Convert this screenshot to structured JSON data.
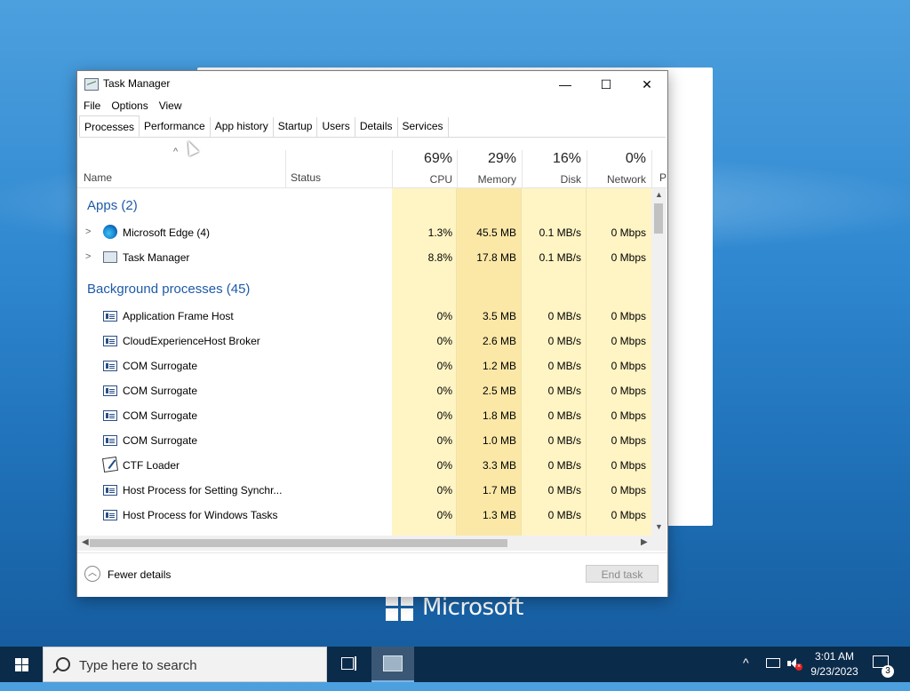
{
  "desktop": {
    "brand_text": "Microsoft"
  },
  "window": {
    "title": "Task Manager",
    "controls": {
      "minimize": "—",
      "maximize": "☐",
      "close": "✕"
    }
  },
  "menu": [
    "File",
    "Options",
    "View"
  ],
  "tabs": [
    "Processes",
    "Performance",
    "App history",
    "Startup",
    "Users",
    "Details",
    "Services"
  ],
  "active_tab": "Processes",
  "columns": {
    "name": "Name",
    "status": "Status",
    "cpu": {
      "pct": "69%",
      "label": "CPU"
    },
    "memory": {
      "pct": "29%",
      "label": "Memory"
    },
    "disk": {
      "pct": "16%",
      "label": "Disk"
    },
    "network": {
      "pct": "0%",
      "label": "Network"
    },
    "truncated": "P"
  },
  "groups": {
    "apps": "Apps (2)",
    "background": "Background processes (45)"
  },
  "apps": [
    {
      "name": "Microsoft Edge (4)",
      "icon": "edge-icon",
      "cpu": "1.3%",
      "memory": "45.5 MB",
      "disk": "0.1 MB/s",
      "network": "0 Mbps"
    },
    {
      "name": "Task Manager",
      "icon": "task-manager-icon",
      "cpu": "8.8%",
      "memory": "17.8 MB",
      "disk": "0.1 MB/s",
      "network": "0 Mbps"
    }
  ],
  "background": [
    {
      "name": "Application Frame Host",
      "icon": "process-icon",
      "cpu": "0%",
      "memory": "3.5 MB",
      "disk": "0 MB/s",
      "network": "0 Mbps"
    },
    {
      "name": "CloudExperienceHost Broker",
      "icon": "process-icon",
      "cpu": "0%",
      "memory": "2.6 MB",
      "disk": "0 MB/s",
      "network": "0 Mbps"
    },
    {
      "name": "COM Surrogate",
      "icon": "process-icon",
      "cpu": "0%",
      "memory": "1.2 MB",
      "disk": "0 MB/s",
      "network": "0 Mbps"
    },
    {
      "name": "COM Surrogate",
      "icon": "process-icon",
      "cpu": "0%",
      "memory": "2.5 MB",
      "disk": "0 MB/s",
      "network": "0 Mbps"
    },
    {
      "name": "COM Surrogate",
      "icon": "process-icon",
      "cpu": "0%",
      "memory": "1.8 MB",
      "disk": "0 MB/s",
      "network": "0 Mbps"
    },
    {
      "name": "COM Surrogate",
      "icon": "process-icon",
      "cpu": "0%",
      "memory": "1.0 MB",
      "disk": "0 MB/s",
      "network": "0 Mbps"
    },
    {
      "name": "CTF Loader",
      "icon": "ctf-loader-icon",
      "cpu": "0%",
      "memory": "3.3 MB",
      "disk": "0 MB/s",
      "network": "0 Mbps"
    },
    {
      "name": "Host Process for Setting Synchr...",
      "icon": "process-icon",
      "cpu": "0%",
      "memory": "1.7 MB",
      "disk": "0 MB/s",
      "network": "0 Mbps"
    },
    {
      "name": "Host Process for Windows Tasks",
      "icon": "process-icon",
      "cpu": "0%",
      "memory": "1.3 MB",
      "disk": "0 MB/s",
      "network": "0 Mbps"
    }
  ],
  "footer": {
    "fewer_details": "Fewer details",
    "end_task": "End task"
  },
  "taskbar": {
    "search_placeholder": "Type here to search",
    "time": "3:01 AM",
    "date": "9/23/2023",
    "notification_count": "3"
  },
  "colors": {
    "cpu_shade": "#fff4c4",
    "memory_shade": "#fbe8a7",
    "disk_shade": "#fff4c4",
    "network_shade": "#fff4c4",
    "group_title": "#1e5aa8"
  }
}
